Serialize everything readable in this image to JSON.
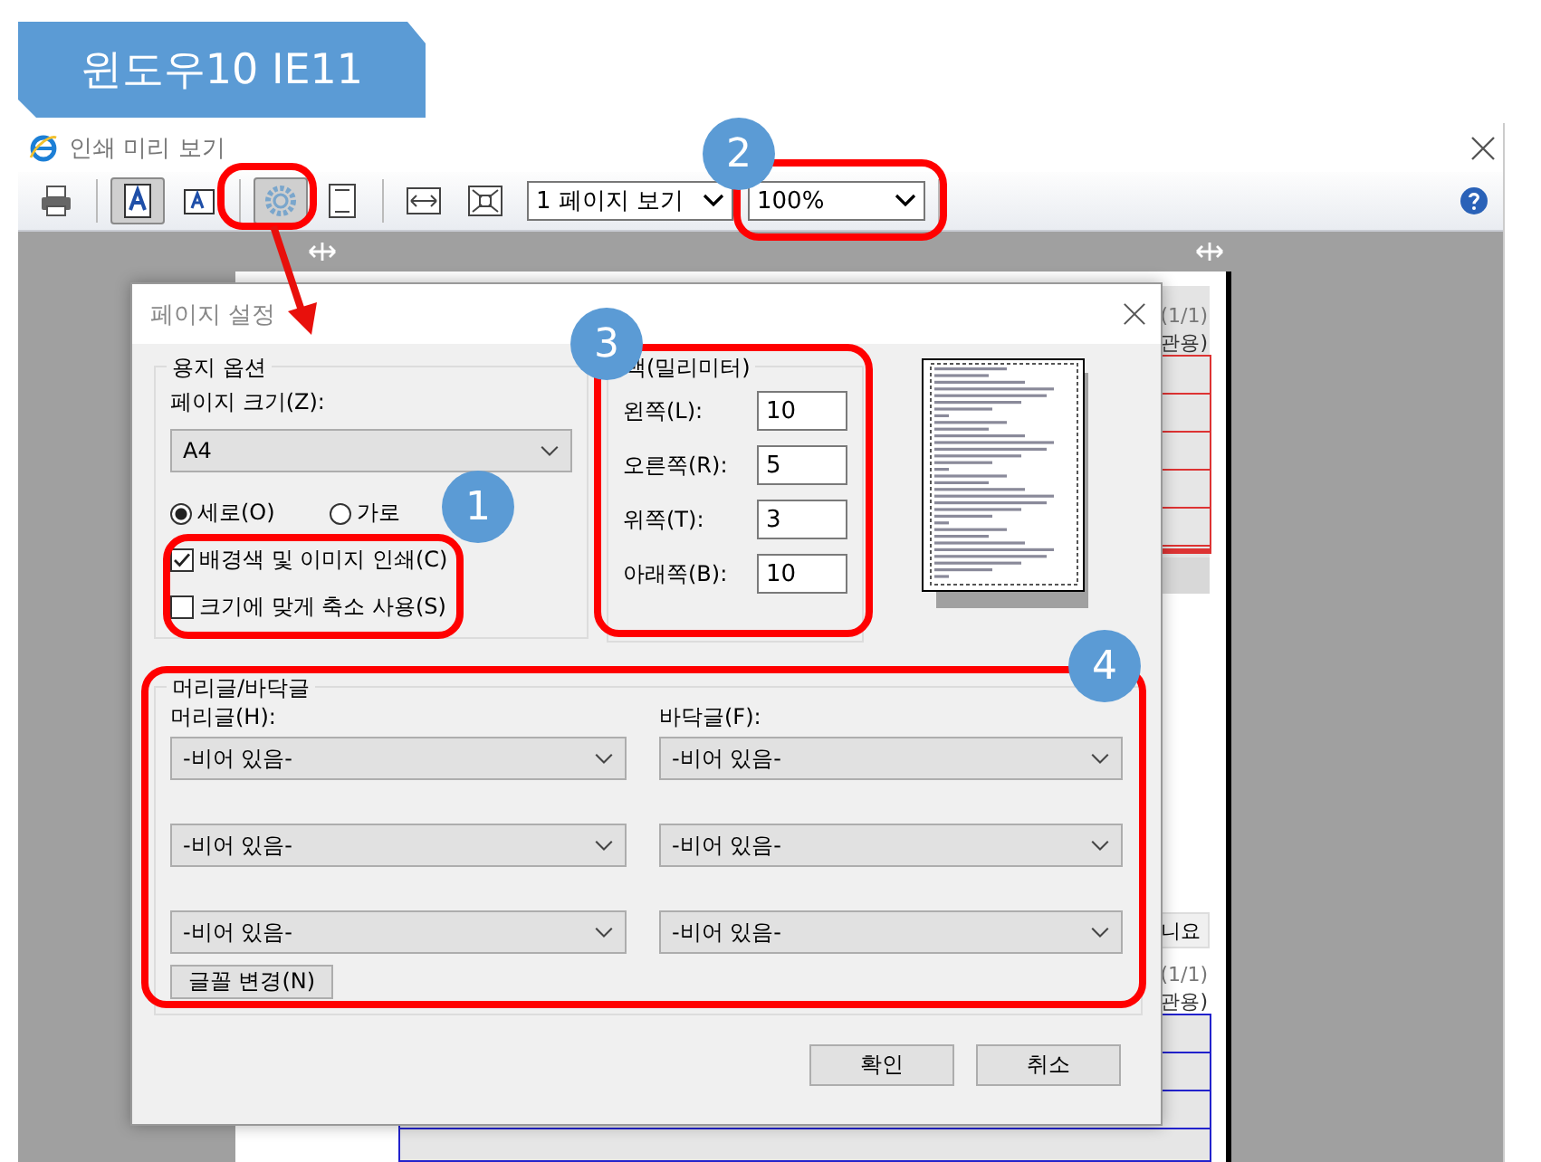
{
  "banner": {
    "text": "윈도우10 IE11"
  },
  "window": {
    "title": "인쇄 미리 보기"
  },
  "toolbar": {
    "buttons": [
      {
        "kind": "print",
        "pressed": false
      },
      {
        "kind": "font-large",
        "pressed": true
      },
      {
        "kind": "font-small",
        "pressed": false
      },
      {
        "kind": "settings",
        "pressed": true
      },
      {
        "kind": "single-page",
        "pressed": false
      },
      {
        "kind": "fit-width",
        "pressed": false
      },
      {
        "kind": "fit-page",
        "pressed": false
      }
    ],
    "view_select": "1 페이지 보기",
    "zoom_select": "100%"
  },
  "preview_page": {
    "top": {
      "page_number": "(1/1)",
      "copy_label": "관용)"
    },
    "middle_button": "니요",
    "bottom": {
      "page_number": "(1/1)",
      "copy_label": "관용)"
    }
  },
  "dialog": {
    "title": "페이지 설정",
    "paper": {
      "legend": "용지 옵션",
      "size_label": "페이지 크기(Z):",
      "size": "A4",
      "orientation": [
        {
          "label": "세로(O)",
          "selected": true
        },
        {
          "label": "가로",
          "selected": false
        }
      ],
      "options": [
        {
          "label": "배경색 및 이미지 인쇄(C)",
          "checked": true
        },
        {
          "label": "크기에 맞게 축소 사용(S)",
          "checked": false
        }
      ]
    },
    "margins": {
      "legend": "백(밀리미터)",
      "fields": [
        {
          "label": "왼쪽(L):",
          "value": "10"
        },
        {
          "label": "오른쪽(R):",
          "value": "5"
        },
        {
          "label": "위쪽(T):",
          "value": "3"
        },
        {
          "label": "아래쪽(B):",
          "value": "10"
        }
      ]
    },
    "header_footer": {
      "legend": "머리글/바닥글",
      "header_label": "머리글(H):",
      "footer_label": "바닥글(F):",
      "rows": [
        {
          "header": "-비어 있음-",
          "footer": "-비어 있음-"
        },
        {
          "header": "-비어 있음-",
          "footer": "-비어 있음-"
        },
        {
          "header": "-비어 있음-",
          "footer": "-비어 있음-"
        }
      ],
      "font_button": "글꼴 변경(N)"
    },
    "buttons": [
      "확인",
      "취소"
    ]
  },
  "annotations": [
    {
      "number": "1"
    },
    {
      "number": "2"
    },
    {
      "number": "3"
    },
    {
      "number": "4"
    }
  ]
}
